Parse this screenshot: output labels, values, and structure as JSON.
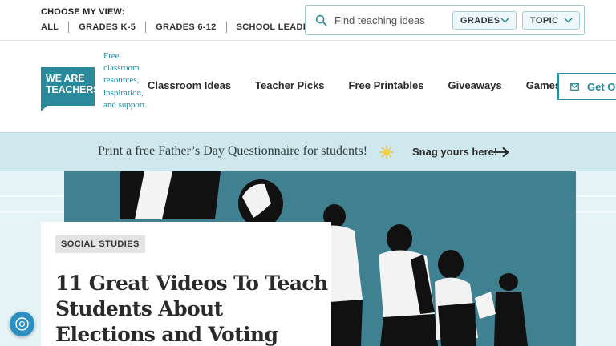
{
  "topbar": {
    "view_label": "CHOOSE MY VIEW:",
    "view_links": [
      "ALL",
      "GRADES K-5",
      "GRADES 6-12",
      "SCHOOL LEADERS"
    ],
    "search_placeholder": "Find teaching ideas",
    "search_icon": "search-icon",
    "filters": {
      "grades_label": "GRADES",
      "topic_label": "TOPIC"
    }
  },
  "header": {
    "logo_line1": "WE ARE",
    "logo_line2": "TEACHERS",
    "tagline": "Free classroom resources, inspiration, and support.",
    "nav": [
      "Classroom Ideas",
      "Teacher Picks",
      "Free Printables",
      "Giveaways",
      "Games"
    ],
    "cta_label": "Get Ou"
  },
  "promo": {
    "text": "Print a free Father’s Day Questionnaire for students!",
    "link_label": "Snag yours here!"
  },
  "article": {
    "category": "SOCIAL STUDIES",
    "title": "11 Great Videos To Teach Students About Elections and Voting"
  },
  "colors": {
    "brand": "#2a8a9c",
    "promo_bg": "#cfe8ed",
    "hero_bg": "#3f8191",
    "chat_button": "#2c8fc1"
  }
}
